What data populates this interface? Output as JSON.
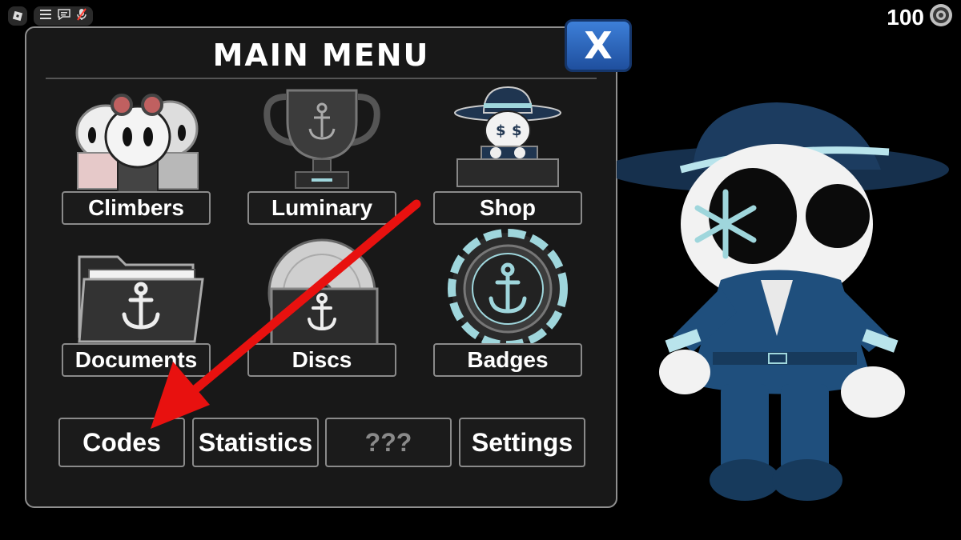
{
  "top_bar": {
    "icons": [
      "roblox-logo-icon",
      "hamburger-menu-icon",
      "chat-icon",
      "microphone-muted-icon"
    ]
  },
  "currency": {
    "value": "100",
    "icon": "coin-icon"
  },
  "menu": {
    "title": "MAIN MENU",
    "close_label": "X",
    "tiles": [
      {
        "label": "Climbers",
        "icon": "climbers-icon"
      },
      {
        "label": "Luminary",
        "icon": "trophy-icon"
      },
      {
        "label": "Shop",
        "icon": "shop-icon"
      },
      {
        "label": "Documents",
        "icon": "folder-icon"
      },
      {
        "label": "Discs",
        "icon": "disc-icon"
      },
      {
        "label": "Badges",
        "icon": "badge-icon"
      }
    ],
    "buttons": [
      {
        "label": "Codes"
      },
      {
        "label": "Statistics"
      },
      {
        "label": "???"
      },
      {
        "label": "Settings"
      }
    ]
  },
  "annotation": {
    "arrow_color": "#e8110f",
    "target": "Codes"
  },
  "colors": {
    "close_button": "#2b63c0",
    "panel_bg": "#181818",
    "accent_teal": "#9fd6dc",
    "character_blue": "#1f4f7d"
  }
}
